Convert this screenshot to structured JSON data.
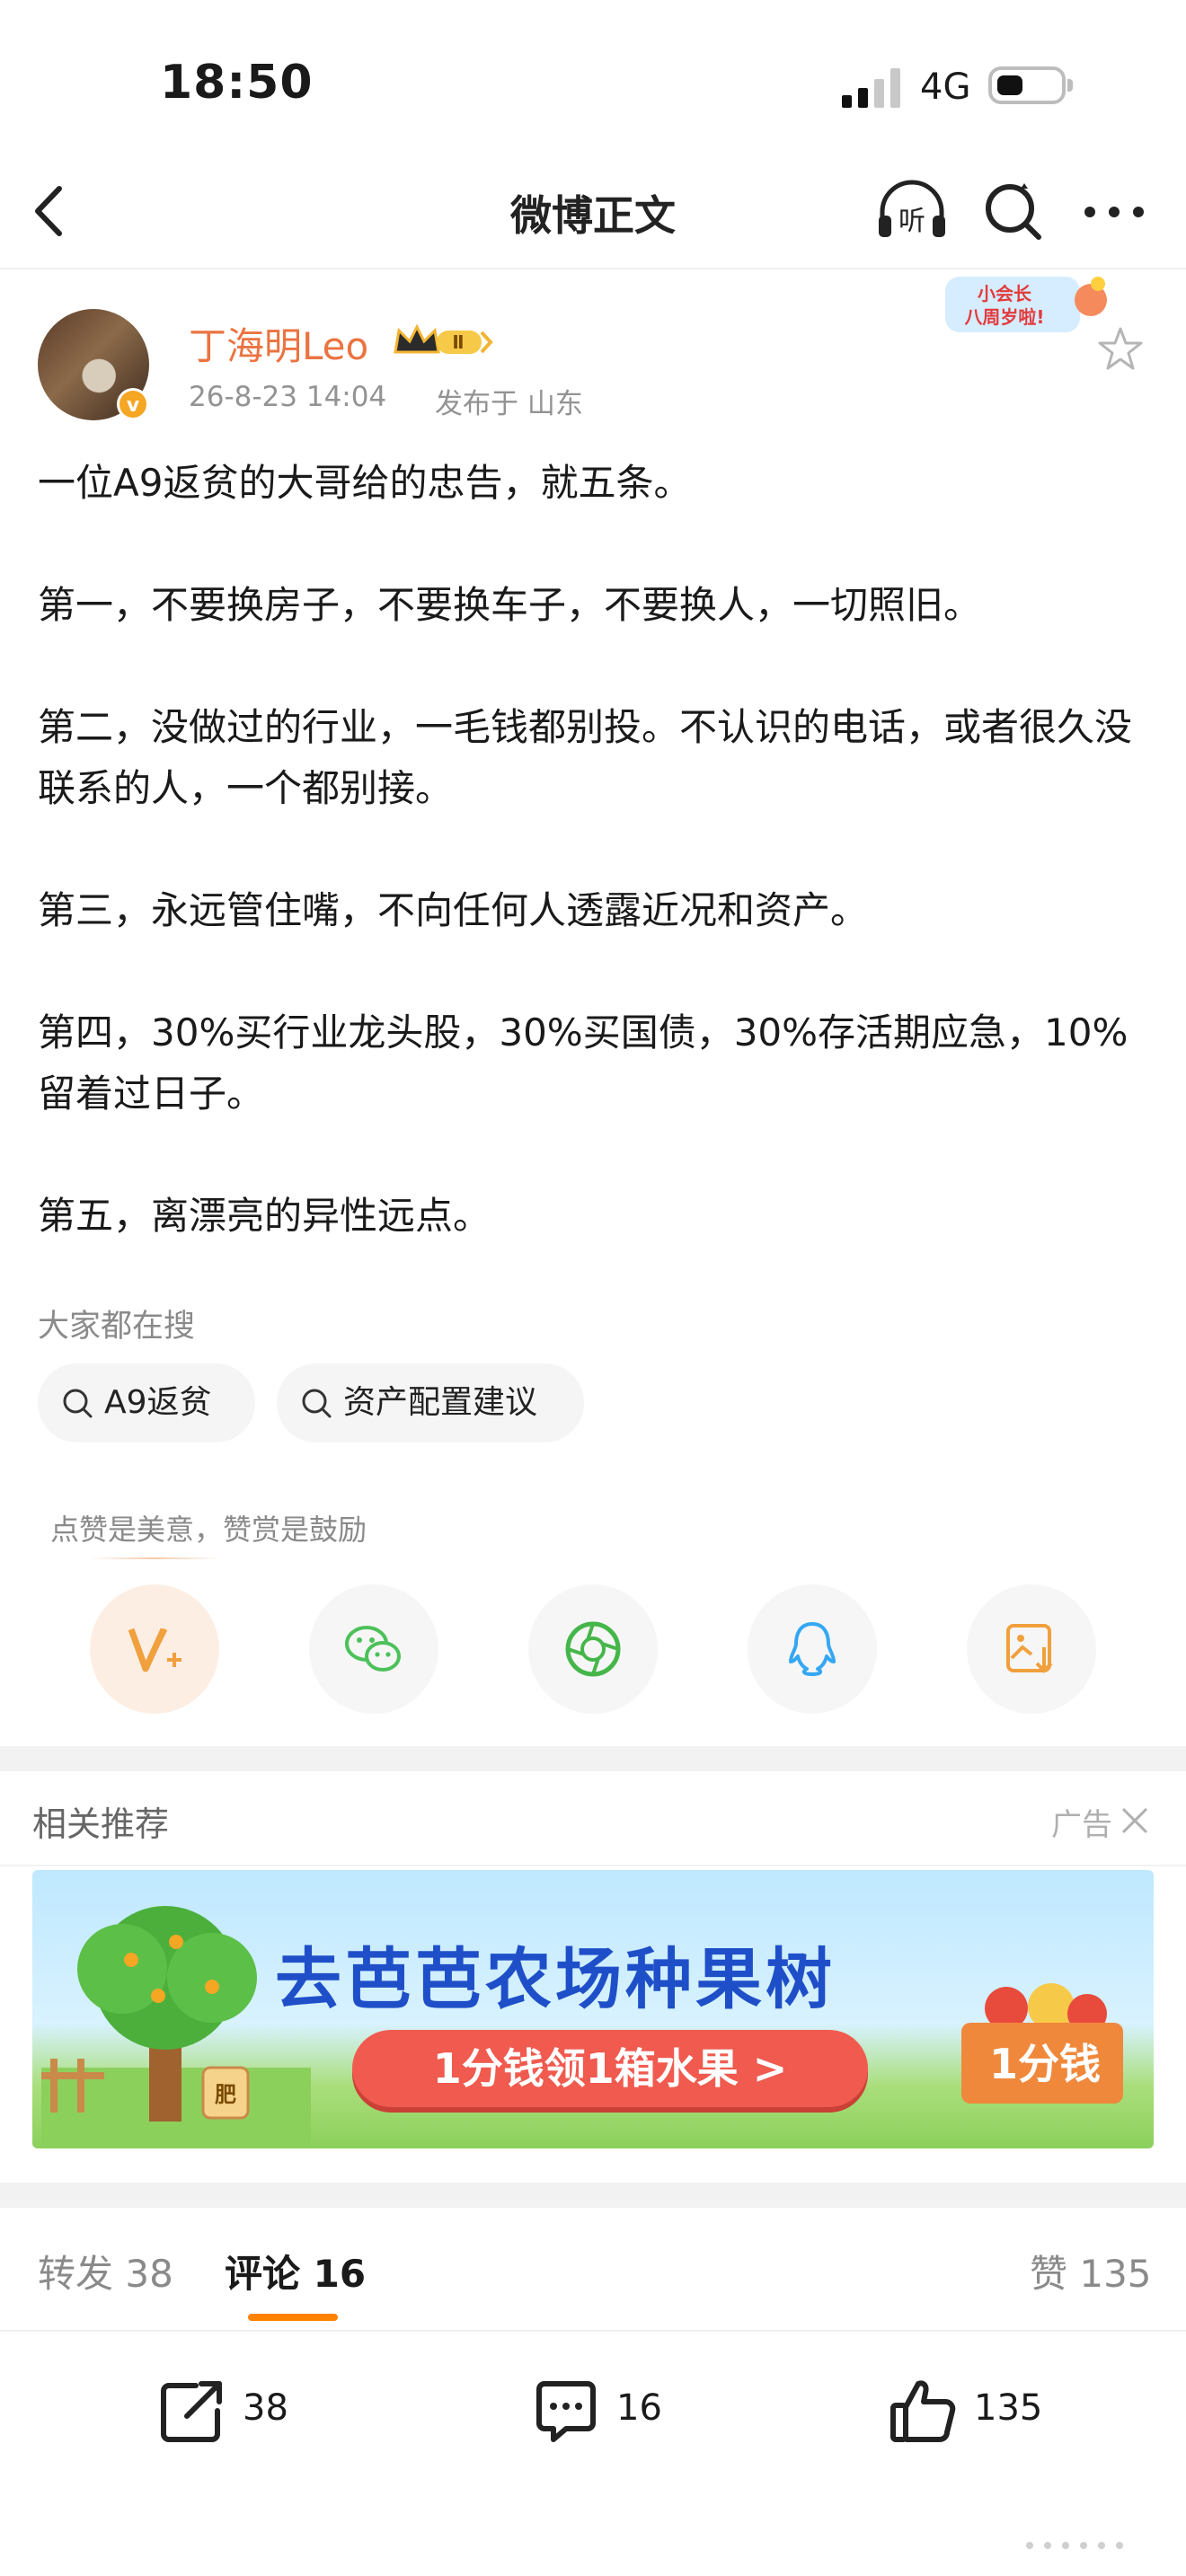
{
  "status_bar": {
    "time": "18:50",
    "network": "4G"
  },
  "nav": {
    "title": "微博正文"
  },
  "author": {
    "name": "丁海明Leo",
    "member_level": "Ⅱ",
    "time": "26-8-23 14:04",
    "location": "发布于 山东",
    "verified_mark": "v"
  },
  "promo_sticker": {
    "line1": "小会长",
    "line2": "八周岁啦!"
  },
  "post": {
    "paragraphs": [
      "一位A9返贫的大哥给的忠告，就五条。",
      "第一，不要换房子，不要换车子，不要换人，一切照旧。",
      "第二，没做过的行业，一毛钱都别投。不认识的电话，或者很久没联系的人，一个都别接。",
      "第三，永远管住嘴，不向任何人透露近况和资产。",
      "第四，30%买行业龙头股，30%买国债，30%存活期应急，10%留着过日子。",
      "第五，离漂亮的异性远点。"
    ]
  },
  "search_hint": "大家都在搜",
  "search_chips": [
    "A9返贫",
    "资产配置建议"
  ],
  "reward_hint": "点赞是美意，赞赏是鼓励",
  "share_icons": [
    "reward-icon",
    "wechat-icon",
    "moments-icon",
    "qq-icon",
    "save-image-icon"
  ],
  "related": {
    "title": "相关推荐",
    "ad_label": "广告"
  },
  "ad": {
    "title": "去芭芭农场种果树",
    "cta": "1分钱领1箱水果 >",
    "price_tag": "1分钱",
    "bucket_label": "肥"
  },
  "tabs": {
    "repost": "转发 38",
    "comment": "评论 16",
    "like": "赞 135"
  },
  "actions": {
    "repost_count": "38",
    "comment_count": "16",
    "like_count": "135"
  },
  "colors": {
    "accent": "#ff8200",
    "author_name": "#eb7340",
    "wechat": "#4cc15a",
    "moments": "#45b649",
    "qq": "#35a7f3",
    "save": "#f0a03c"
  }
}
